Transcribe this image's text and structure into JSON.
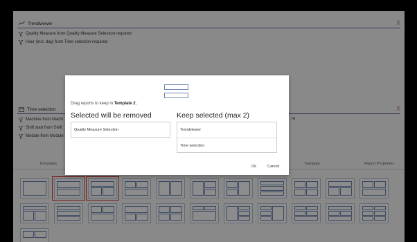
{
  "trendviewer": {
    "title": "Trendviewer",
    "close": "X",
    "filters": [
      "Quality Measure from Quality Measure Selection required",
      "Hour (incl. day) from Time selection required"
    ]
  },
  "time_selection": {
    "title": "Time selection",
    "close": "X",
    "filters": [
      "Machine from Machi",
      "Shift start from Shift",
      "Module from Module"
    ],
    "right_fragment": "re"
  },
  "tabs": {
    "templates": "Templates",
    "navigate": "Navigate",
    "report_properties": "Report Properties"
  },
  "dialog": {
    "instruction_prefix": "Drag reports to keep in",
    "instruction_template": "Template 2.",
    "removed_title": "Selected will be removed",
    "keep_title": "Keep selected (max 2)",
    "removed_items": [
      "Quality Measure Selection"
    ],
    "keep_items": [
      "Trendviewer",
      "Time selection"
    ],
    "ok": "Ok",
    "cancel": "Cancel"
  }
}
